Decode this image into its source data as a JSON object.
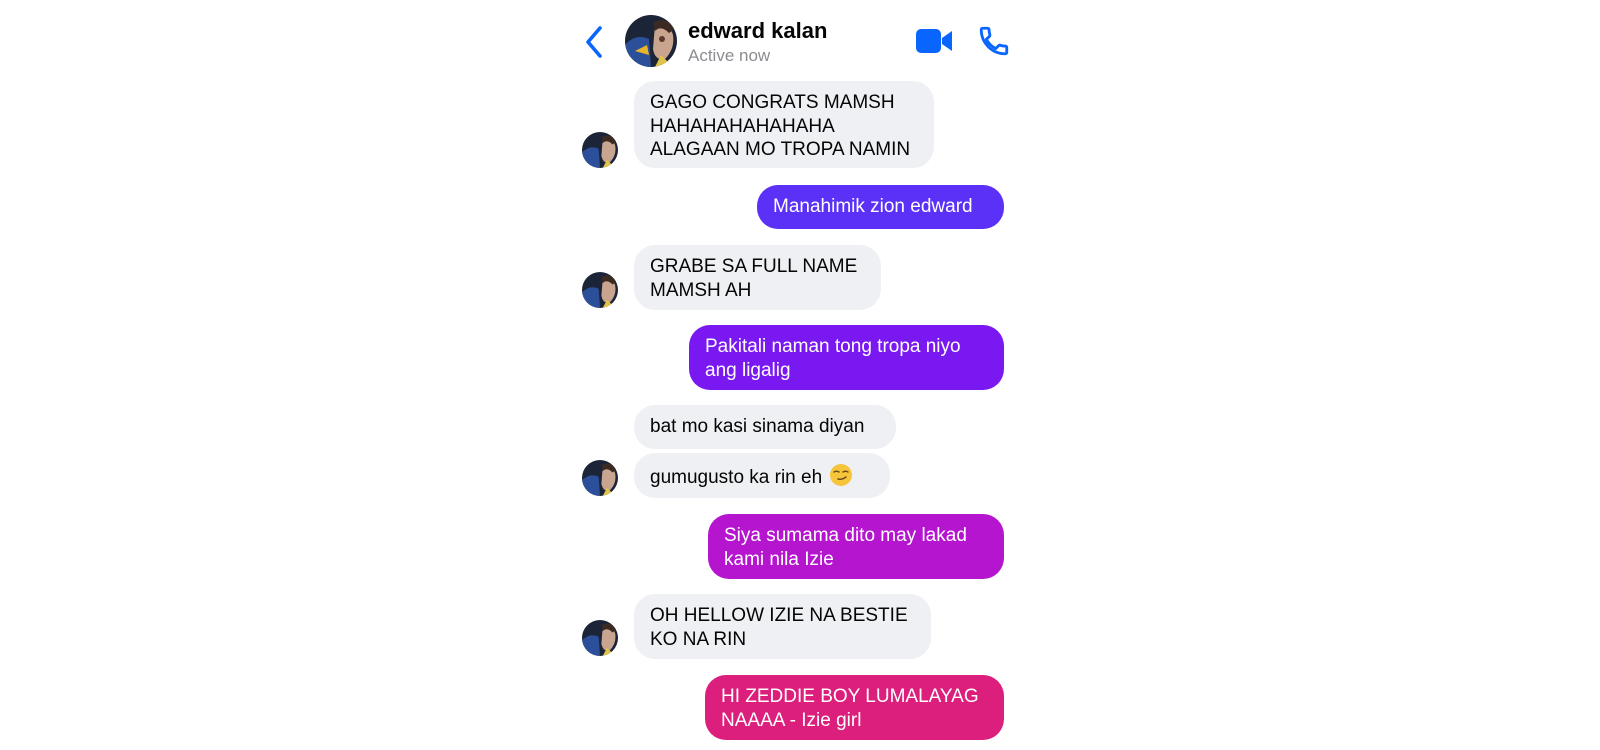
{
  "header": {
    "contact_name": "edward kalan",
    "status": "Active now",
    "back_icon": "chevron-left-icon",
    "video_icon": "video-camera-icon",
    "call_icon": "phone-icon",
    "accent_color": "#0866ff"
  },
  "messages": [
    {
      "from": "them",
      "lines": [
        "GAGO CONGRATS MAMSH",
        "HAHAHAHAHAHAHA",
        "ALAGAAN MO TROPA NAMIN"
      ]
    },
    {
      "from": "me",
      "lines": [
        "Manahimik zion edward"
      ],
      "color": "#5b30f7"
    },
    {
      "from": "them",
      "lines": [
        "GRABE SA FULL NAME",
        "MAMSH AH"
      ]
    },
    {
      "from": "me",
      "lines": [
        "Pakitali naman tong tropa niyo",
        "ang ligalig"
      ],
      "color": "#7a18f2"
    },
    {
      "from": "them",
      "lines": [
        "bat mo kasi sinama diyan"
      ]
    },
    {
      "from": "them",
      "lines": [
        "gumugusto ka rin eh"
      ],
      "emoji": "smirking-face-emoji"
    },
    {
      "from": "me",
      "lines": [
        "Siya sumama dito may lakad",
        "kami nila Izie"
      ],
      "color": "#b515cf"
    },
    {
      "from": "them",
      "lines": [
        "OH HELLOW IZIE NA BESTIE",
        "KO NA RIN"
      ]
    },
    {
      "from": "me",
      "lines": [
        "HI ZEDDIE BOY LUMALAYAG",
        "NAAAA - Izie girl"
      ],
      "color": "#dc1e7c"
    }
  ]
}
